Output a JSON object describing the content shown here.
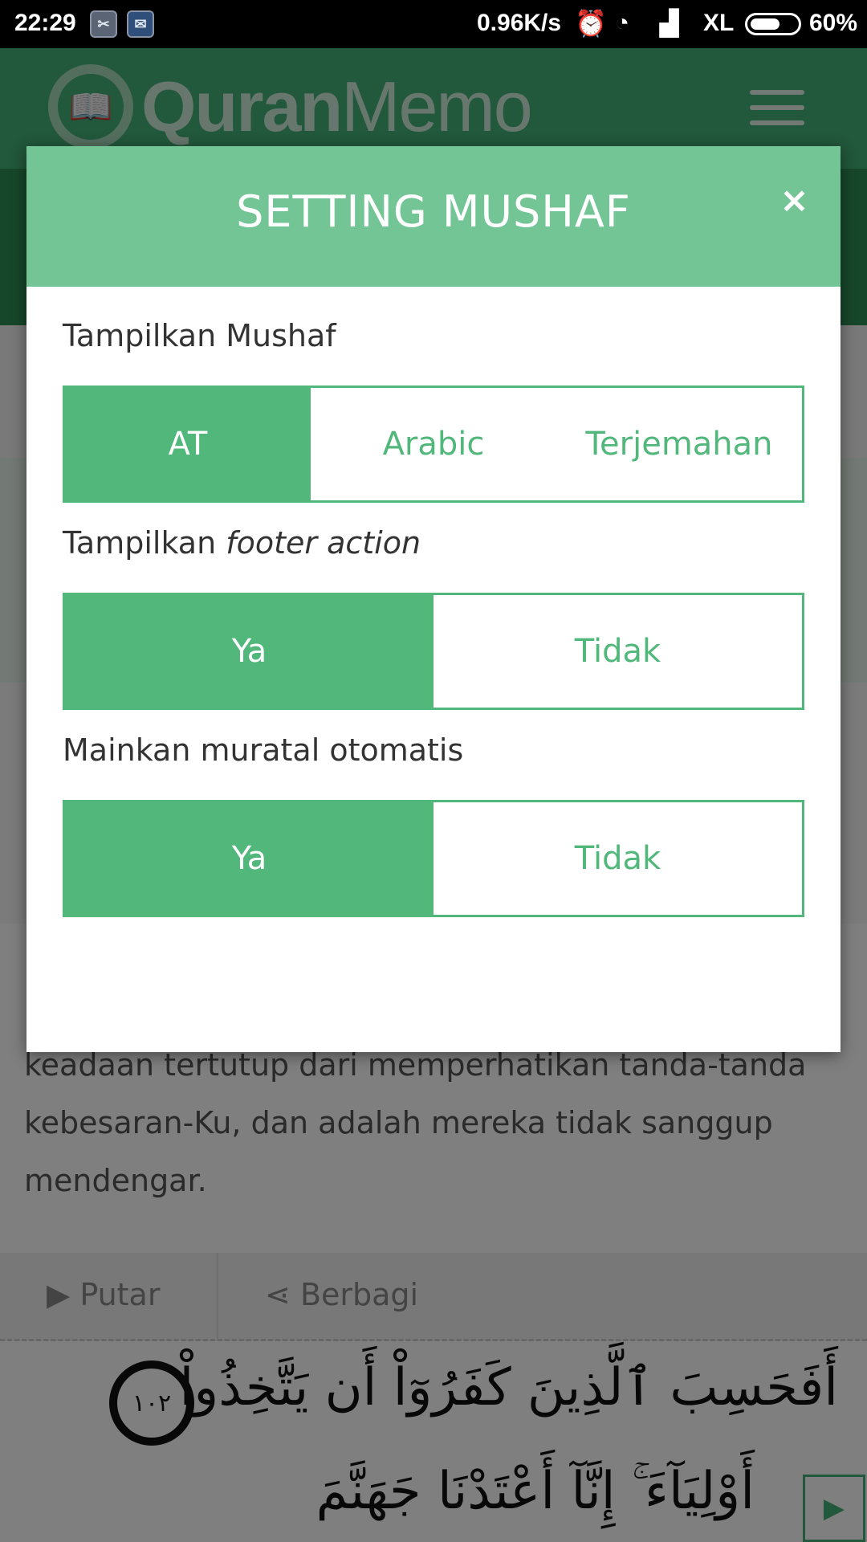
{
  "statusbar": {
    "time": "22:29",
    "speed": "0.96K/s",
    "carrier": "XL",
    "battery": "60%"
  },
  "header": {
    "logo_bold": "Quran",
    "logo_light": "Memo"
  },
  "background": {
    "verse_text": "keadaan tertutup dari memperhatikan tanda-tanda kebesaran-Ku, dan adalah mereka tidak sanggup mendengar.",
    "play_label": "Putar",
    "share_label": "Berbagi",
    "arabic_line1": "أَفَحَسِبَ ٱلَّذِينَ كَفَرُوٓاْ أَن يَتَّخِذُواْ",
    "ayah_number": "١٠٢",
    "arabic_line2": "أَوْلِيَآءَ ۚ إِنَّآ أَعْتَدْنَا جَهَنَّمَ"
  },
  "modal": {
    "title": "SETTING MUSHAF",
    "close": "×",
    "show_mushaf": {
      "label": "Tampilkan Mushaf",
      "options": [
        "AT",
        "Arabic",
        "Terjemahan"
      ],
      "selected": "AT"
    },
    "footer_action": {
      "label_plain": "Tampilkan ",
      "label_italic": "footer action",
      "options": [
        "Ya",
        "Tidak"
      ],
      "selected": "Ya"
    },
    "autoplay": {
      "label": "Mainkan muratal otomatis",
      "options": [
        "Ya",
        "Tidak"
      ],
      "selected": "Ya"
    }
  },
  "colors": {
    "primary": "#51b77b",
    "modal_header": "#73c595",
    "app_header": "#45b177"
  },
  "icons": {
    "close": "close-icon",
    "menu": "hamburger-menu-icon",
    "play": "play-icon",
    "share": "share-icon"
  }
}
